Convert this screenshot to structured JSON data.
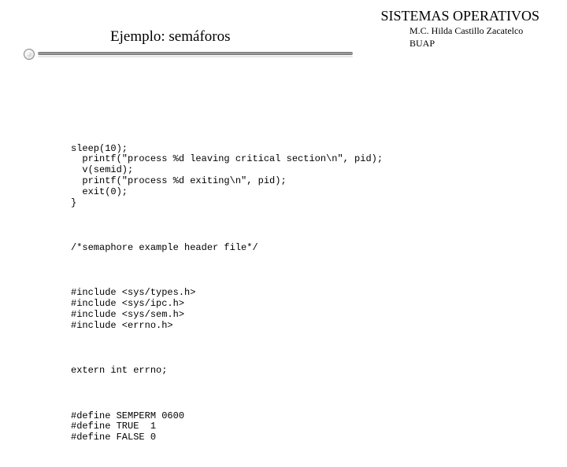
{
  "header": {
    "title": "SISTEMAS OPERATIVOS",
    "subtitle": "Ejemplo: semáforos",
    "author": "M.C. Hilda Castillo Zacatelco",
    "institution": "BUAP"
  },
  "code": {
    "block1": "sleep(10);\n  printf(\"process %d leaving critical section\\n\", pid);\n  v(semid);\n  printf(\"process %d exiting\\n\", pid);\n  exit(0);\n}",
    "block2": "/*semaphore example header file*/",
    "block3": "#include <sys/types.h>\n#include <sys/ipc.h>\n#include <sys/sem.h>\n#include <errno.h>",
    "block4": "extern int errno;",
    "block5": "#define SEMPERM 0600\n#define TRUE  1\n#define FALSE 0"
  }
}
